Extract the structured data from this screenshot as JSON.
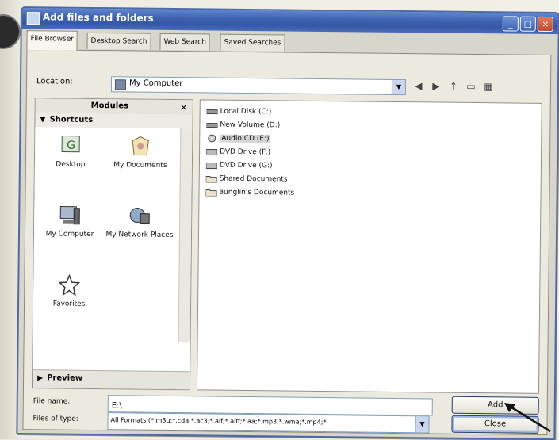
{
  "window": {
    "title": "Add files and folders"
  },
  "tabs": [
    {
      "label": "File Browser"
    },
    {
      "label": "Desktop Search"
    },
    {
      "label": "Web Search"
    },
    {
      "label": "Saved Searches"
    }
  ],
  "location": {
    "label": "Location:",
    "value": "My Computer"
  },
  "modules": {
    "title": "Modules",
    "close_glyph": "×"
  },
  "shortcuts": {
    "header": "Shortcuts",
    "items": [
      {
        "label": "Desktop",
        "icon": "desktop-icon"
      },
      {
        "label": "My Documents",
        "icon": "my-documents-icon"
      },
      {
        "label": "My Computer",
        "icon": "my-computer-icon"
      },
      {
        "label": "My Network Places",
        "icon": "network-places-icon"
      },
      {
        "label": "Favorites",
        "icon": "favorites-star-icon"
      }
    ]
  },
  "preview": {
    "header": "Preview"
  },
  "files": [
    {
      "name": "Local Disk (C:)",
      "icon": "hard-disk-icon"
    },
    {
      "name": "New Volume (D:)",
      "icon": "hard-disk-icon"
    },
    {
      "name": "Audio CD (E:)",
      "icon": "audio-cd-icon",
      "selected": true
    },
    {
      "name": "DVD Drive (F:)",
      "icon": "dvd-drive-icon"
    },
    {
      "name": "DVD Drive (G:)",
      "icon": "dvd-drive-icon"
    },
    {
      "name": "Shared Documents",
      "icon": "folder-icon"
    },
    {
      "name": "aunglin's Documents",
      "icon": "folder-icon"
    }
  ],
  "filename": {
    "label": "File name:",
    "value": "E:\\"
  },
  "filetype": {
    "label": "Files of type:",
    "value": "All Formats (*.m3u;*.cda;*.ac3;*.aif;*.aiff;*.aa;*.mp3;*.wma;*.mp4;*"
  },
  "buttons": {
    "add": "Add",
    "close": "Close"
  },
  "colors": {
    "titlebar": "#3f63b1",
    "selection": "#d7d7d7"
  }
}
